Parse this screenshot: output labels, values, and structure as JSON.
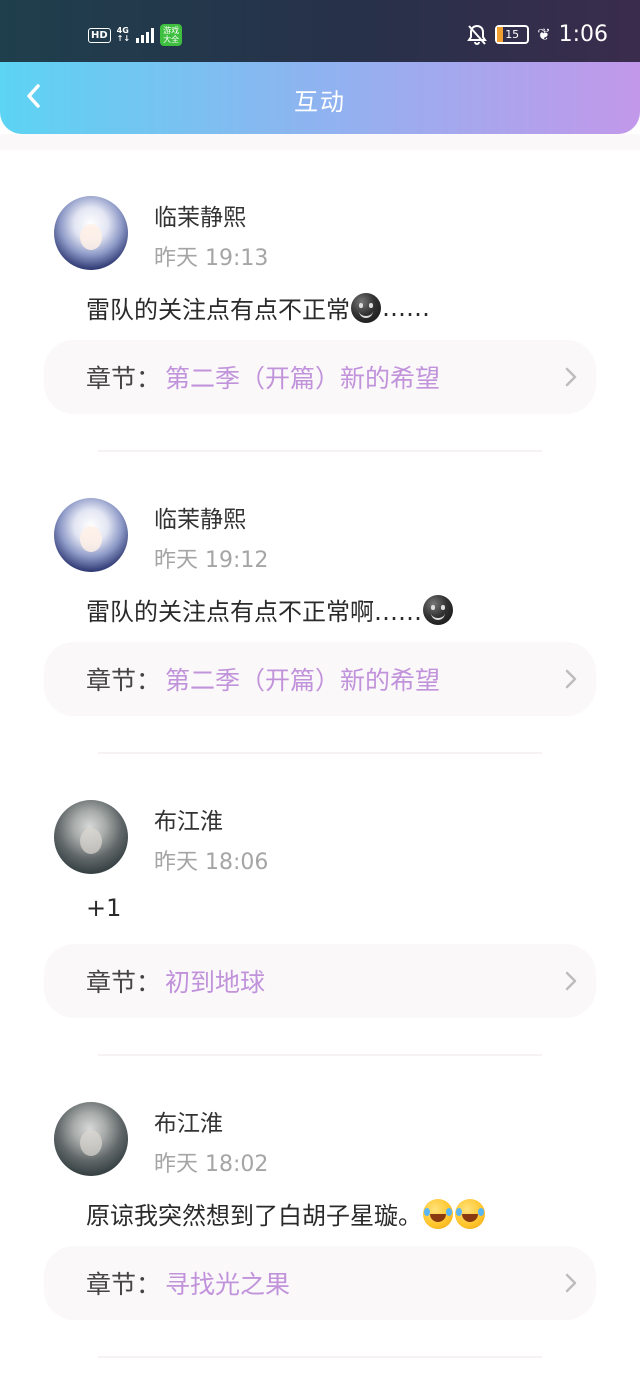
{
  "status_bar": {
    "hd": "HD",
    "network": "4G",
    "app_badge": "游戏大全",
    "battery": "15",
    "time": "1:06"
  },
  "header": {
    "title": "互动"
  },
  "interactions": [
    {
      "name": "临茉静熙",
      "time": "昨天 19:13",
      "content_before": "雷队的关注点有点不正常",
      "emoji": [
        "smiling-face-dark"
      ],
      "content_after": "……",
      "chapter_label": "章节：",
      "chapter_title": "第二季（开篇）新的希望"
    },
    {
      "name": "临茉静熙",
      "time": "昨天 19:12",
      "content_before": "雷队的关注点有点不正常啊……",
      "emoji": [
        "smiling-face-dark"
      ],
      "content_after": "",
      "chapter_label": "章节：",
      "chapter_title": "第二季（开篇）新的希望"
    },
    {
      "name": "布江淮",
      "time": "昨天 18:06",
      "content_before": "+1",
      "emoji": [],
      "content_after": "",
      "chapter_label": "章节：",
      "chapter_title": "初到地球"
    },
    {
      "name": "布江淮",
      "time": "昨天 18:02",
      "content_before": "原谅我突然想到了白胡子星璇。",
      "emoji": [
        "tears-of-joy",
        "tears-of-joy"
      ],
      "content_after": "",
      "chapter_label": "章节：",
      "chapter_title": "寻找光之果"
    }
  ],
  "colors": {
    "header_gradient": [
      "#5cd4f3",
      "#c298ea"
    ],
    "chapter_title": "#c193db",
    "timestamp": "#a5a5a5"
  }
}
